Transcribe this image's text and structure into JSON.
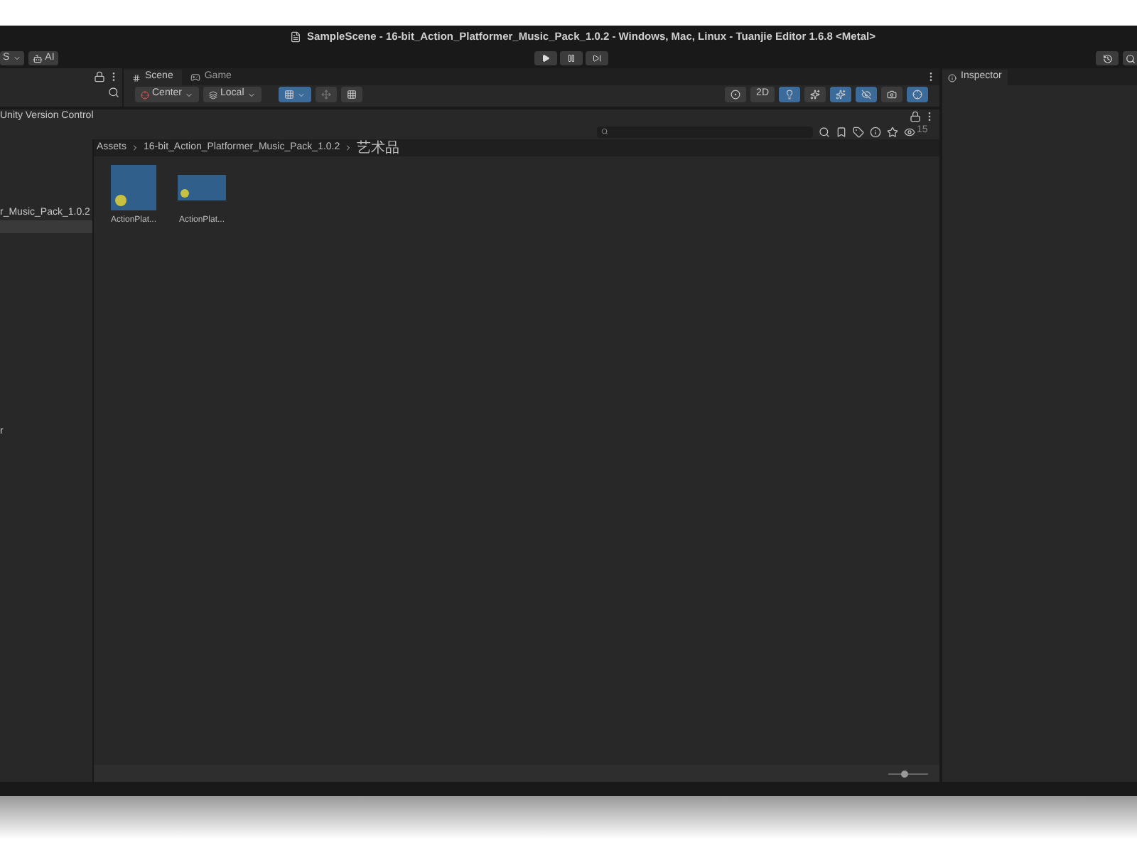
{
  "title_bar": {
    "title": "SampleScene - 16-bit_Action_Platformer_Music_Pack_1.0.2 - Windows, Mac, Linux - Tuanjie Editor 1.6.8 <Metal>"
  },
  "toolbar": {
    "account_fragment": "S",
    "ai_label": "AI"
  },
  "scene": {
    "tabs": [
      {
        "label": "Scene",
        "selected": true
      },
      {
        "label": "Game",
        "selected": false
      }
    ],
    "pivot": "Center",
    "space": "Local",
    "mode_2d": "2D"
  },
  "inspector": {
    "tab": "Inspector"
  },
  "project": {
    "version_control": "Unity Version Control",
    "visible_count": "15",
    "tree": [
      {
        "label": "r_Music_Pack_1.0.2",
        "selected": false
      },
      {
        "label": "r",
        "selected": false
      }
    ],
    "breadcrumb": [
      "Assets",
      "16-bit_Action_Platformer_Music_Pack_1.0.2",
      "艺术品"
    ],
    "assets": [
      {
        "name": "ActionPlat...",
        "kind": "square"
      },
      {
        "name": "ActionPlat...",
        "kind": "wide"
      }
    ],
    "zoom": {
      "level": 0.4
    }
  }
}
